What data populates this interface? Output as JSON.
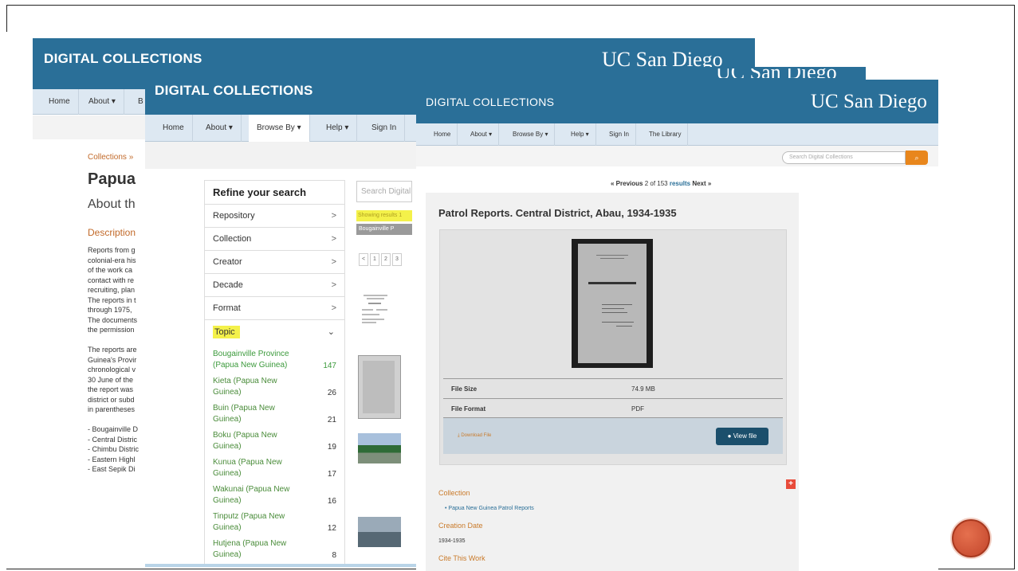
{
  "window_back": {
    "title": "DIGITAL COLLECTIONS",
    "logo": "UC San Diego",
    "nav": [
      "Home",
      "About ▾",
      "B"
    ],
    "breadcrumb": "Collections »",
    "page_title": "Papua",
    "about_heading": "About th",
    "description_heading": "Description",
    "description_lines": [
      "Reports from g",
      "colonial-era his",
      "of the work ca",
      "contact with re",
      "recruiting, plan",
      "The reports in t",
      "through 1975, ",
      "The documents",
      "the permission",
      "",
      "The reports are",
      "Guinea's Provir",
      "chronological v",
      "30 June of the",
      "the report was",
      "district or subd",
      "in parentheses",
      "",
      "- Bougainville D",
      "- Central Distric",
      "- Chimbu Distric",
      "- Eastern Highl",
      "- East Sepik Di"
    ]
  },
  "window_middle": {
    "title": "DIGITAL COLLECTIONS",
    "logo": "UC San Diego",
    "nav": [
      "Home",
      "About ▾",
      "Browse By ▾",
      "Help ▾",
      "Sign In"
    ],
    "refine": {
      "heading": "Refine your search",
      "facets": [
        "Repository",
        "Collection",
        "Creator",
        "Decade",
        "Format"
      ],
      "topic_label": "Topic",
      "topic_items": [
        {
          "label": "Bougainville Province (Papua New Guinea)",
          "count": "147"
        },
        {
          "label": "Kieta (Papua New Guinea)",
          "count": "26"
        },
        {
          "label": "Buin (Papua New Guinea)",
          "count": "21"
        },
        {
          "label": "Boku (Papua New Guinea)",
          "count": "19"
        },
        {
          "label": "Kunua (Papua New Guinea)",
          "count": "17"
        },
        {
          "label": "Wakunai (Papua New Guinea)",
          "count": "16"
        },
        {
          "label": "Tinputz (Papua New Guinea)",
          "count": "12"
        },
        {
          "label": "Hutjena (Papua New Guinea)",
          "count": "8"
        }
      ]
    },
    "search_placeholder": "Search Digital",
    "showing_text": "Showing results 1",
    "chip_text": "Bougainville P",
    "pager": [
      "<",
      "1",
      "2",
      "3"
    ]
  },
  "window_front": {
    "title": "DIGITAL COLLECTIONS",
    "logo": "UC San Diego",
    "nav": [
      "Home",
      "About ▾",
      "Browse By ▾",
      "Help ▾",
      "Sign In",
      "The Library"
    ],
    "search_placeholder": "Search Digital Collections",
    "pagination": {
      "prev": "« Previous",
      "position": "2 of 153",
      "results": "results",
      "next": "Next »"
    },
    "record_title": "Patrol Reports. Central District, Abau, 1934-1935",
    "file_size_label": "File Size",
    "file_size_value": "74.9 MB",
    "file_format_label": "File Format",
    "file_format_value": "PDF",
    "download_label": "⤓ Download File",
    "view_file_label": "● View file",
    "plus_label": "+",
    "collection_heading": "Collection",
    "collection_value": "• Papua New Guinea Patrol Reports",
    "creation_date_heading": "Creation Date",
    "creation_date_value": "1934-1935",
    "cite_heading": "Cite This Work"
  },
  "colors": {
    "header_blue": "#2a6f98",
    "nav_bg": "#dde8f2",
    "accent_orange": "#c97a2a",
    "highlight_yellow": "#f4f14a",
    "search_button": "#e8861c"
  }
}
